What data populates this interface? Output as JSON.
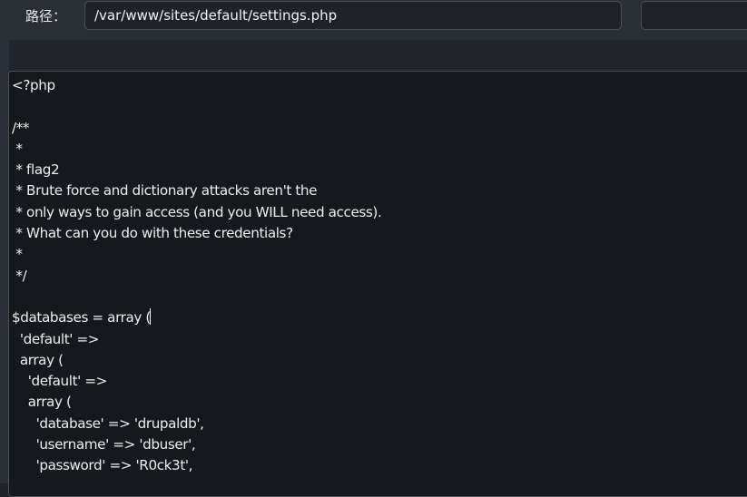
{
  "path_bar": {
    "label": "路径：",
    "value": "/var/www/sites/default/settings.php"
  },
  "editor": {
    "lines": [
      "<?php",
      "",
      "/**",
      " *",
      " * flag2",
      " * Brute force and dictionary attacks aren't the",
      " * only ways to gain access (and you WILL need access).",
      " * What can you do with these credentials?",
      " *",
      " */",
      "",
      "$databases = array (",
      "  'default' =>",
      "  array (",
      "    'default' =>",
      "    array (",
      "      'database' => 'drupaldb',",
      "      'username' => 'dbuser',",
      "      'password' => 'R0ck3t',"
    ]
  }
}
